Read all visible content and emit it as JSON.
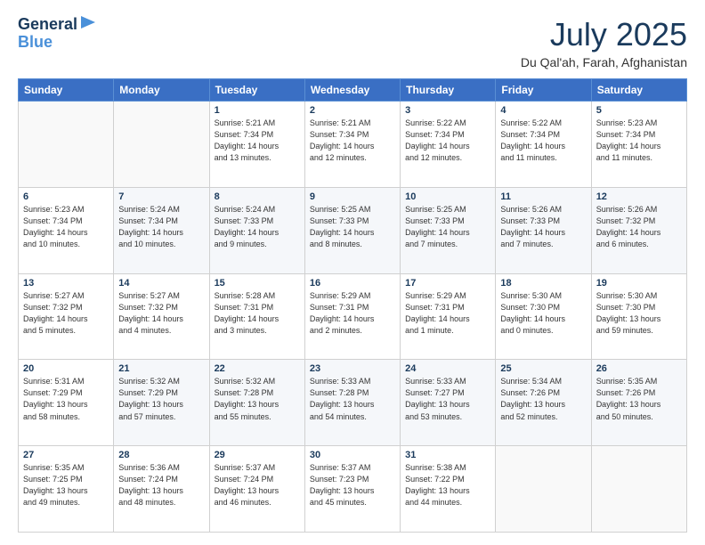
{
  "logo": {
    "line1": "General",
    "line2": "Blue"
  },
  "title": "July 2025",
  "subtitle": "Du Qal'ah, Farah, Afghanistan",
  "days_of_week": [
    "Sunday",
    "Monday",
    "Tuesday",
    "Wednesday",
    "Thursday",
    "Friday",
    "Saturday"
  ],
  "weeks": [
    [
      {
        "day": "",
        "info": ""
      },
      {
        "day": "",
        "info": ""
      },
      {
        "day": "1",
        "info": "Sunrise: 5:21 AM\nSunset: 7:34 PM\nDaylight: 14 hours\nand 13 minutes."
      },
      {
        "day": "2",
        "info": "Sunrise: 5:21 AM\nSunset: 7:34 PM\nDaylight: 14 hours\nand 12 minutes."
      },
      {
        "day": "3",
        "info": "Sunrise: 5:22 AM\nSunset: 7:34 PM\nDaylight: 14 hours\nand 12 minutes."
      },
      {
        "day": "4",
        "info": "Sunrise: 5:22 AM\nSunset: 7:34 PM\nDaylight: 14 hours\nand 11 minutes."
      },
      {
        "day": "5",
        "info": "Sunrise: 5:23 AM\nSunset: 7:34 PM\nDaylight: 14 hours\nand 11 minutes."
      }
    ],
    [
      {
        "day": "6",
        "info": "Sunrise: 5:23 AM\nSunset: 7:34 PM\nDaylight: 14 hours\nand 10 minutes."
      },
      {
        "day": "7",
        "info": "Sunrise: 5:24 AM\nSunset: 7:34 PM\nDaylight: 14 hours\nand 10 minutes."
      },
      {
        "day": "8",
        "info": "Sunrise: 5:24 AM\nSunset: 7:33 PM\nDaylight: 14 hours\nand 9 minutes."
      },
      {
        "day": "9",
        "info": "Sunrise: 5:25 AM\nSunset: 7:33 PM\nDaylight: 14 hours\nand 8 minutes."
      },
      {
        "day": "10",
        "info": "Sunrise: 5:25 AM\nSunset: 7:33 PM\nDaylight: 14 hours\nand 7 minutes."
      },
      {
        "day": "11",
        "info": "Sunrise: 5:26 AM\nSunset: 7:33 PM\nDaylight: 14 hours\nand 7 minutes."
      },
      {
        "day": "12",
        "info": "Sunrise: 5:26 AM\nSunset: 7:32 PM\nDaylight: 14 hours\nand 6 minutes."
      }
    ],
    [
      {
        "day": "13",
        "info": "Sunrise: 5:27 AM\nSunset: 7:32 PM\nDaylight: 14 hours\nand 5 minutes."
      },
      {
        "day": "14",
        "info": "Sunrise: 5:27 AM\nSunset: 7:32 PM\nDaylight: 14 hours\nand 4 minutes."
      },
      {
        "day": "15",
        "info": "Sunrise: 5:28 AM\nSunset: 7:31 PM\nDaylight: 14 hours\nand 3 minutes."
      },
      {
        "day": "16",
        "info": "Sunrise: 5:29 AM\nSunset: 7:31 PM\nDaylight: 14 hours\nand 2 minutes."
      },
      {
        "day": "17",
        "info": "Sunrise: 5:29 AM\nSunset: 7:31 PM\nDaylight: 14 hours\nand 1 minute."
      },
      {
        "day": "18",
        "info": "Sunrise: 5:30 AM\nSunset: 7:30 PM\nDaylight: 14 hours\nand 0 minutes."
      },
      {
        "day": "19",
        "info": "Sunrise: 5:30 AM\nSunset: 7:30 PM\nDaylight: 13 hours\nand 59 minutes."
      }
    ],
    [
      {
        "day": "20",
        "info": "Sunrise: 5:31 AM\nSunset: 7:29 PM\nDaylight: 13 hours\nand 58 minutes."
      },
      {
        "day": "21",
        "info": "Sunrise: 5:32 AM\nSunset: 7:29 PM\nDaylight: 13 hours\nand 57 minutes."
      },
      {
        "day": "22",
        "info": "Sunrise: 5:32 AM\nSunset: 7:28 PM\nDaylight: 13 hours\nand 55 minutes."
      },
      {
        "day": "23",
        "info": "Sunrise: 5:33 AM\nSunset: 7:28 PM\nDaylight: 13 hours\nand 54 minutes."
      },
      {
        "day": "24",
        "info": "Sunrise: 5:33 AM\nSunset: 7:27 PM\nDaylight: 13 hours\nand 53 minutes."
      },
      {
        "day": "25",
        "info": "Sunrise: 5:34 AM\nSunset: 7:26 PM\nDaylight: 13 hours\nand 52 minutes."
      },
      {
        "day": "26",
        "info": "Sunrise: 5:35 AM\nSunset: 7:26 PM\nDaylight: 13 hours\nand 50 minutes."
      }
    ],
    [
      {
        "day": "27",
        "info": "Sunrise: 5:35 AM\nSunset: 7:25 PM\nDaylight: 13 hours\nand 49 minutes."
      },
      {
        "day": "28",
        "info": "Sunrise: 5:36 AM\nSunset: 7:24 PM\nDaylight: 13 hours\nand 48 minutes."
      },
      {
        "day": "29",
        "info": "Sunrise: 5:37 AM\nSunset: 7:24 PM\nDaylight: 13 hours\nand 46 minutes."
      },
      {
        "day": "30",
        "info": "Sunrise: 5:37 AM\nSunset: 7:23 PM\nDaylight: 13 hours\nand 45 minutes."
      },
      {
        "day": "31",
        "info": "Sunrise: 5:38 AM\nSunset: 7:22 PM\nDaylight: 13 hours\nand 44 minutes."
      },
      {
        "day": "",
        "info": ""
      },
      {
        "day": "",
        "info": ""
      }
    ]
  ]
}
